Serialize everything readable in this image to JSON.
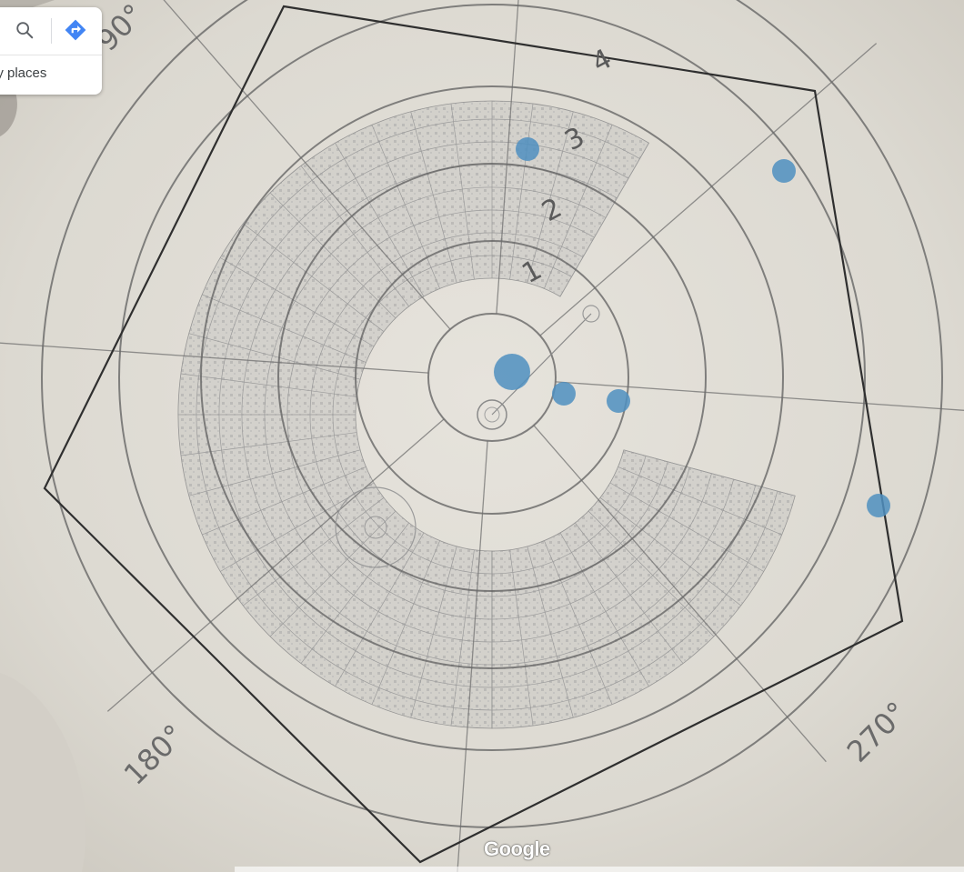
{
  "search": {
    "suggestion_text": "py places",
    "search_icon": "search-icon",
    "directions_icon": "directions-icon"
  },
  "map": {
    "ring_labels": [
      "1",
      "2",
      "3",
      "4"
    ],
    "degree_labels": [
      "90°",
      "180°",
      "270°"
    ],
    "colors": {
      "playa": "#dedbd3",
      "grid_lines": "#5f5f5f",
      "boundary": "#2f2f2f",
      "markers": "#4f8fc0"
    },
    "marker_icon": "blue-dot-marker"
  },
  "footer": {
    "logo": "Google"
  }
}
